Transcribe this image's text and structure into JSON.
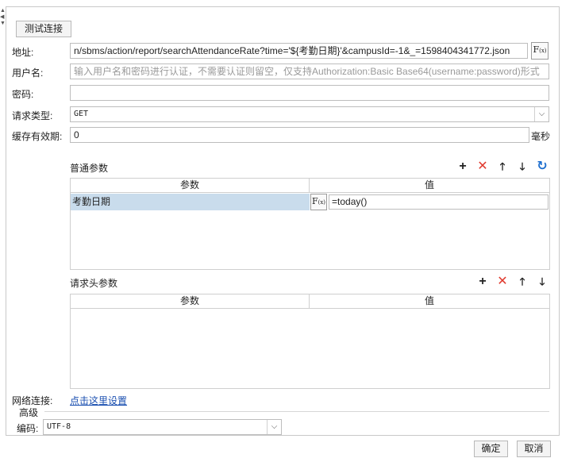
{
  "toolbar": {
    "test_connection": "测试连接"
  },
  "form": {
    "url_label": "地址:",
    "url_value": "n/sbms/action/report/searchAttendanceRate?time='${考勤日期}'&campusId=-1&_=1598404341772.json",
    "username_label": "用户名:",
    "username_placeholder": "输入用户名和密码进行认证，不需要认证则留空，仅支持Authorization:Basic Base64(username:password)形式",
    "password_label": "密码:",
    "password_value": "",
    "request_type_label": "请求类型:",
    "request_type_value": "GET",
    "cache_label": "缓存有效期:",
    "cache_value": "0",
    "cache_unit": "毫秒"
  },
  "params": {
    "title": "普通参数",
    "col_param": "参数",
    "col_value": "值",
    "rows": [
      {
        "name": "考勤日期",
        "value": "=today()"
      }
    ]
  },
  "headers": {
    "title": "请求头参数",
    "col_param": "参数",
    "col_value": "值"
  },
  "network": {
    "label": "网络连接:",
    "link": "点击这里设置"
  },
  "advanced": {
    "title": "高级",
    "encoding_label": "编码:",
    "encoding_value": "UTF-8"
  },
  "footer": {
    "ok": "确定",
    "cancel": "取消"
  },
  "icons": {
    "fx": "F",
    "fx_sub": "(x)",
    "add": "+",
    "delete": "✕",
    "up": "🡑",
    "down": "🡓",
    "refresh": "↻",
    "chevron": "⌵"
  },
  "colors": {
    "delete": "#e03a2e",
    "refresh": "#1f6fcf",
    "selected_row": "#c9dcec",
    "link": "#1a4fb0"
  }
}
